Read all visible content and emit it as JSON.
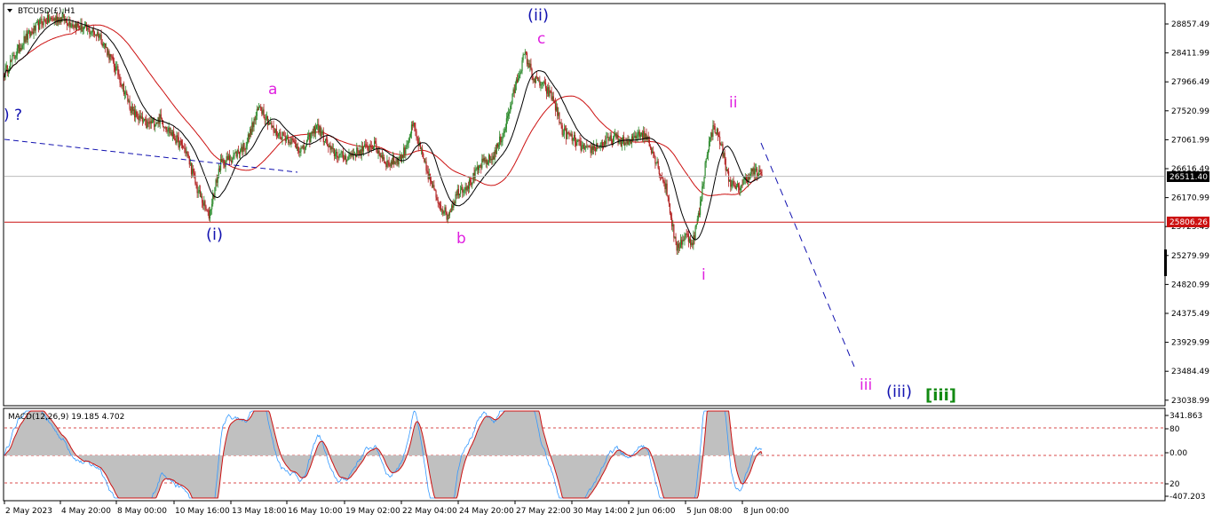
{
  "symbol": {
    "title": "BTCUSD(£),H1"
  },
  "indicator": {
    "title": "MACD(12,26,9) 19.185 4.702"
  },
  "colors": {
    "background": "#ffffff",
    "bull_candle": "#2e8b2e",
    "bear_candle": "#b22222",
    "ma_slow": "#cc1111",
    "ma_fast": "#000000",
    "support": "#cc1111",
    "wave_blue": "#1212b0",
    "wave_magenta": "#e020e0",
    "wave_green": "#128a12",
    "macd_line": "#3399ff",
    "macd_signal": "#cc1111",
    "macd_histogram": "#c0c0c0",
    "price_marker_bg": "#000000"
  },
  "chart_data": [
    {
      "type": "candlestick",
      "title": "BTCUSD(£),H1",
      "y_ticks": [
        "28857.49",
        "28411.99",
        "27966.49",
        "27520.99",
        "27061.99",
        "26616.49",
        "26170.99",
        "25725.49",
        "25279.99",
        "24820.99",
        "24375.49",
        "23929.99",
        "23484.49",
        "23038.99"
      ],
      "ylim": [
        23038.99,
        29000
      ],
      "x_ticks": [
        "2 May 2023",
        "4 May 20:00",
        "8 May 00:00",
        "10 May 16:00",
        "13 May 18:00",
        "16 May 10:00",
        "19 May 02:00",
        "22 May 04:00",
        "24 May 20:00",
        "27 May 22:00",
        "30 May 14:00",
        "2 Jun 06:00",
        "5 Jun 08:00",
        "8 Jun 00:00"
      ],
      "current_price": {
        "label": "26511.40",
        "value": 26511.4
      },
      "support_level": {
        "label": "25806.26",
        "value": 25806.26
      },
      "price_path": [
        {
          "time": "2 May 2023",
          "price": 28100
        },
        {
          "time": "3 May",
          "price": 28600
        },
        {
          "time": "4 May 06:00",
          "price": 28900
        },
        {
          "time": "4 May 20:00",
          "price": 28950
        },
        {
          "time": "5 May",
          "price": 28800
        },
        {
          "time": "7 May",
          "price": 28700
        },
        {
          "time": "8 May 00:00",
          "price": 28100
        },
        {
          "time": "9 May",
          "price": 27500
        },
        {
          "time": "9 May 18:00",
          "price": 27300
        },
        {
          "time": "10 May 06:00",
          "price": 27400
        },
        {
          "time": "10 May 16:00",
          "price": 27100
        },
        {
          "time": "11 May",
          "price": 26900
        },
        {
          "time": "11 May 16:00",
          "price": 26300
        },
        {
          "time": "12 May",
          "price": 25900
        },
        {
          "time": "12 May 18:00",
          "price": 26700
        },
        {
          "time": "13 May 18:00",
          "price": 26800
        },
        {
          "time": "14 May",
          "price": 27000
        },
        {
          "time": "15 May",
          "price": 27600
        },
        {
          "time": "15 May 18:00",
          "price": 27200
        },
        {
          "time": "16 May 10:00",
          "price": 27100
        },
        {
          "time": "17 May",
          "price": 26900
        },
        {
          "time": "18 May",
          "price": 27300
        },
        {
          "time": "18 May 18:00",
          "price": 26900
        },
        {
          "time": "19 May 02:00",
          "price": 26800
        },
        {
          "time": "20 May",
          "price": 26900
        },
        {
          "time": "21 May",
          "price": 27000
        },
        {
          "time": "21 May 18:00",
          "price": 26700
        },
        {
          "time": "22 May 04:00",
          "price": 26800
        },
        {
          "time": "23 May",
          "price": 27300
        },
        {
          "time": "23 May 18:00",
          "price": 26700
        },
        {
          "time": "24 May",
          "price": 26200
        },
        {
          "time": "24 May 12:00",
          "price": 25900
        },
        {
          "time": "24 May 20:00",
          "price": 26300
        },
        {
          "time": "25 May",
          "price": 26400
        },
        {
          "time": "26 May",
          "price": 26700
        },
        {
          "time": "27 May",
          "price": 26800
        },
        {
          "time": "27 May 12:00",
          "price": 27200
        },
        {
          "time": "27 May 22:00",
          "price": 27900
        },
        {
          "time": "28 May 04:00",
          "price": 28400
        },
        {
          "time": "28 May 12:00",
          "price": 28000
        },
        {
          "time": "29 May",
          "price": 27900
        },
        {
          "time": "29 May 18:00",
          "price": 27700
        },
        {
          "time": "30 May 06:00",
          "price": 27200
        },
        {
          "time": "30 May 14:00",
          "price": 27100
        },
        {
          "time": "31 May",
          "price": 26900
        },
        {
          "time": "1 Jun",
          "price": 27000
        },
        {
          "time": "1 Jun 18:00",
          "price": 27100
        },
        {
          "time": "2 Jun 06:00",
          "price": 27000
        },
        {
          "time": "3 Jun",
          "price": 27200
        },
        {
          "time": "4 Jun",
          "price": 27100
        },
        {
          "time": "4 Jun 18:00",
          "price": 26700
        },
        {
          "time": "5 Jun 00:00",
          "price": 26300
        },
        {
          "time": "5 Jun 04:00",
          "price": 25400
        },
        {
          "time": "5 Jun 08:00",
          "price": 25600
        },
        {
          "time": "5 Jun 14:00",
          "price": 25500
        },
        {
          "time": "6 Jun",
          "price": 26000
        },
        {
          "time": "6 Jun 12:00",
          "price": 26900
        },
        {
          "time": "6 Jun 18:00",
          "price": 27300
        },
        {
          "time": "7 Jun",
          "price": 27000
        },
        {
          "time": "7 Jun 12:00",
          "price": 26500
        },
        {
          "time": "7 Jun 18:00",
          "price": 26300
        },
        {
          "time": "8 Jun 00:00",
          "price": 26400
        },
        {
          "time": "8 Jun 06:00",
          "price": 26600
        },
        {
          "time": "8 Jun 12:00",
          "price": 26511.4
        }
      ],
      "wave_labels": [
        {
          "text": ") ?",
          "color": "blue"
        },
        {
          "text": "(i)",
          "color": "blue",
          "time": "12 May",
          "price": 25700
        },
        {
          "text": "a",
          "color": "magenta",
          "time": "15 May",
          "price": 27950
        },
        {
          "text": "b",
          "color": "magenta",
          "time": "24 May 12:00",
          "price": 25650
        },
        {
          "text": "c",
          "color": "magenta",
          "time": "28 May 04:00",
          "price": 28700
        },
        {
          "text": "(ii)",
          "color": "blue",
          "time": "28 May 04:00",
          "price": 29000
        },
        {
          "text": "i",
          "color": "magenta",
          "time": "5 Jun 08:00",
          "price": 25000
        },
        {
          "text": "ii",
          "color": "magenta",
          "time": "6 Jun 18:00",
          "price": 27700
        },
        {
          "text": "iii",
          "color": "magenta"
        },
        {
          "text": "(iii)",
          "color": "blue"
        },
        {
          "text": "[iii]",
          "color": "green"
        }
      ]
    },
    {
      "type": "histogram+line",
      "title": "MACD(12,26,9) 19.185 4.702",
      "y_ticks": [
        "341.863",
        "80",
        "0.00",
        "20",
        "-407.203"
      ],
      "levels": [
        80,
        0,
        -80
      ],
      "macd_line_value": 19.185,
      "signal_value": 4.702
    }
  ]
}
